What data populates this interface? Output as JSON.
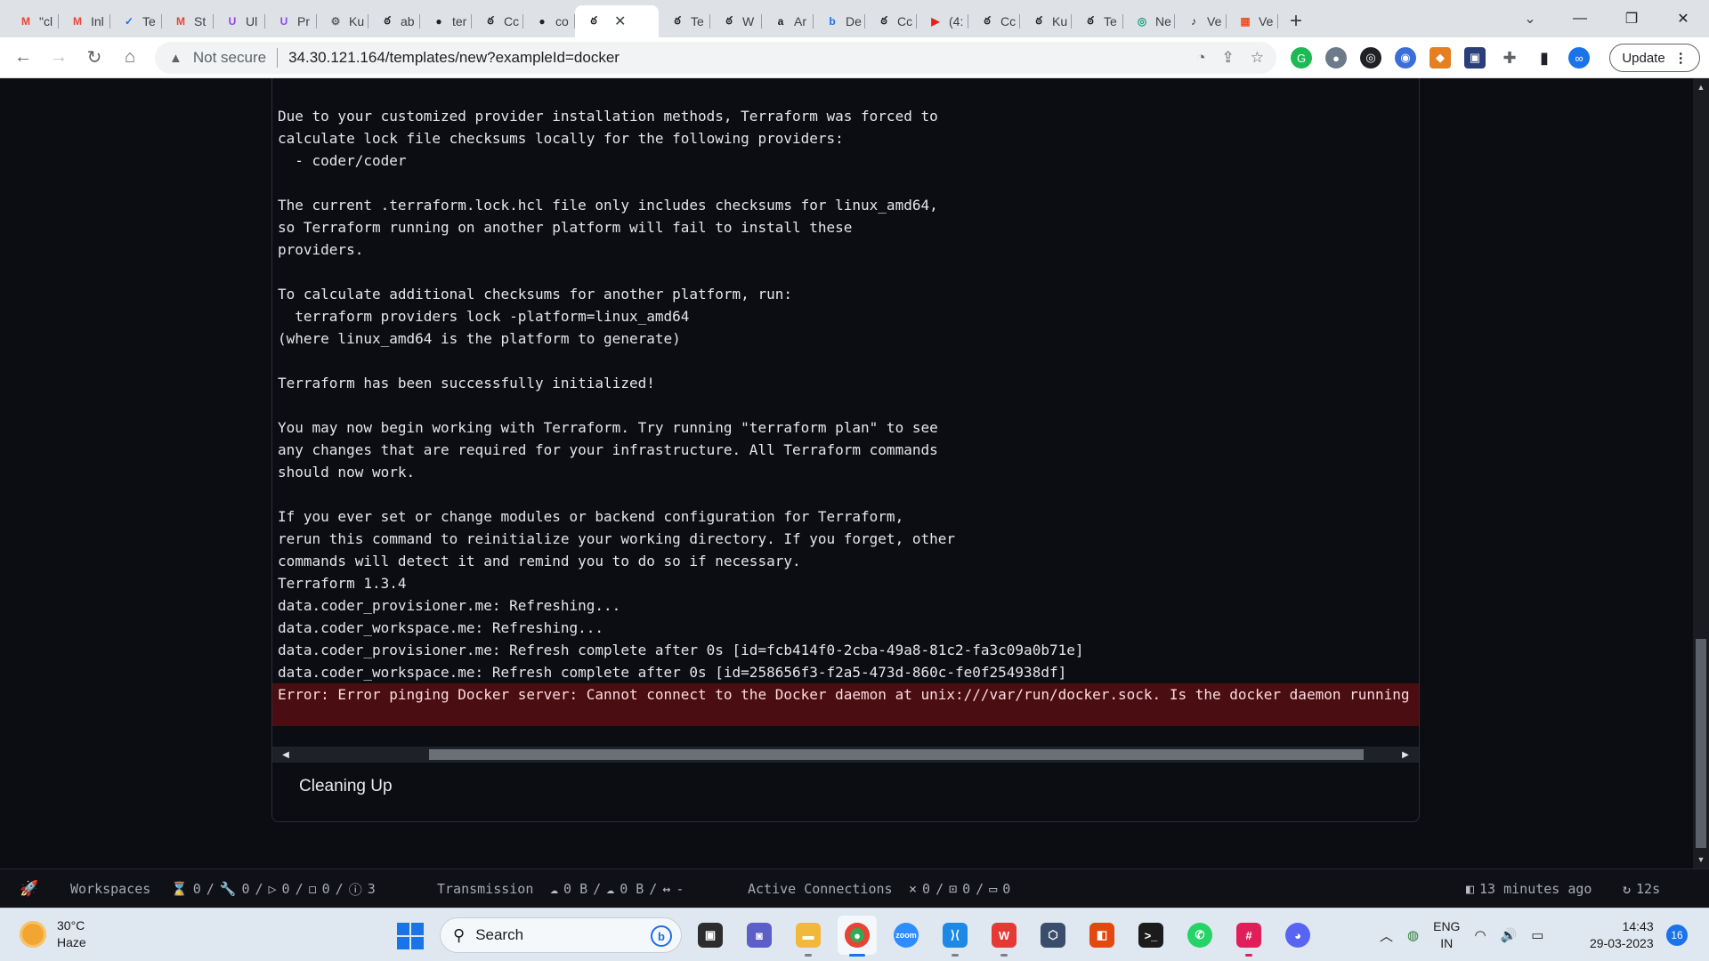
{
  "browser": {
    "tabs": [
      {
        "label": "\"cl",
        "icon": "gmail-icon",
        "glyph": "M",
        "color": "#ea4335"
      },
      {
        "label": "Inl",
        "icon": "gmail-icon",
        "glyph": "M",
        "color": "#ea4335"
      },
      {
        "label": "Te",
        "icon": "checkbox-app-icon",
        "glyph": "✓",
        "color": "#1a73e8"
      },
      {
        "label": "St",
        "icon": "gmail-icon",
        "glyph": "M",
        "color": "#ea4335"
      },
      {
        "label": "Ul",
        "icon": "purple-app-icon",
        "glyph": "U",
        "color": "#8e44ef"
      },
      {
        "label": "Pr",
        "icon": "purple-app-icon",
        "glyph": "U",
        "color": "#8e44ef"
      },
      {
        "label": "Ku",
        "icon": "gear-app-icon",
        "glyph": "⚙",
        "color": "#5f6368"
      },
      {
        "label": "ab",
        "icon": "coder-icon",
        "glyph": "ఠ",
        "color": "#202124"
      },
      {
        "label": "ter",
        "icon": "github-icon",
        "glyph": "●",
        "color": "#202124"
      },
      {
        "label": "Cc",
        "icon": "coder-icon",
        "glyph": "ఠ",
        "color": "#202124"
      },
      {
        "label": "co",
        "icon": "github-icon",
        "glyph": "●",
        "color": "#202124"
      },
      {
        "label": "",
        "icon": "coder-icon",
        "glyph": "ఠ",
        "color": "#202124",
        "active": true
      },
      {
        "label": "Te",
        "icon": "coder-icon",
        "glyph": "ఠ",
        "color": "#202124"
      },
      {
        "label": "W",
        "icon": "coder-icon",
        "glyph": "ఠ",
        "color": "#202124"
      },
      {
        "label": "Ar",
        "icon": "amazon-icon",
        "glyph": "a",
        "color": "#202124"
      },
      {
        "label": "De",
        "icon": "bing-app-icon",
        "glyph": "b",
        "color": "#1a73e8"
      },
      {
        "label": "Cc",
        "icon": "coder-icon",
        "glyph": "ఠ",
        "color": "#202124"
      },
      {
        "label": "(4:",
        "icon": "youtube-icon",
        "glyph": "▶",
        "color": "#e62117"
      },
      {
        "label": "Cc",
        "icon": "coder-icon",
        "glyph": "ఠ",
        "color": "#202124"
      },
      {
        "label": "Ku",
        "icon": "coder-icon",
        "glyph": "ఠ",
        "color": "#202124"
      },
      {
        "label": "Te",
        "icon": "coder-icon",
        "glyph": "ఠ",
        "color": "#202124"
      },
      {
        "label": "Ne",
        "icon": "chatgpt-icon",
        "glyph": "◎",
        "color": "#10a37f"
      },
      {
        "label": "Ve",
        "icon": "music-note-icon",
        "glyph": "♪",
        "color": "#202124"
      },
      {
        "label": "Ve",
        "icon": "microsoft-icon",
        "glyph": "▦",
        "color": "#f25022"
      }
    ],
    "security_label": "Not secure",
    "url": "34.30.121.164/templates/new?exampleId=docker",
    "update_label": "Update"
  },
  "log": {
    "lines": [
      "Due to your customized provider installation methods, Terraform was forced to",
      "calculate lock file checksums locally for the following providers:",
      "  - coder/coder",
      "",
      "The current .terraform.lock.hcl file only includes checksums for linux_amd64,",
      "so Terraform running on another platform will fail to install these",
      "providers.",
      "",
      "To calculate additional checksums for another platform, run:",
      "  terraform providers lock -platform=linux_amd64",
      "(where linux_amd64 is the platform to generate)",
      "",
      "Terraform has been successfully initialized!",
      "",
      "You may now begin working with Terraform. Try running \"terraform plan\" to see",
      "any changes that are required for your infrastructure. All Terraform commands",
      "should now work.",
      "",
      "If you ever set or change modules or backend configuration for Terraform,",
      "rerun this command to reinitialize your working directory. If you forget, other",
      "commands will detect it and remind you to do so if necessary.",
      "Terraform 1.3.4",
      "data.coder_provisioner.me: Refreshing...",
      "data.coder_workspace.me: Refreshing...",
      "data.coder_provisioner.me: Refresh complete after 0s [id=fcb414f0-2cba-49a8-81c2-fa3c09a0b71e]",
      "data.coder_workspace.me: Refresh complete after 0s [id=258656f3-f2a5-473d-860c-fe0f254938df]"
    ],
    "error": "Error: Error pinging Docker server: Cannot connect to the Docker daemon at unix:///var/run/docker.sock. Is the docker daemon running"
  },
  "stage": {
    "label": "Cleaning Up"
  },
  "statusbar": {
    "workspaces_label": "Workspaces",
    "pending": "0",
    "starting": "0",
    "running": "0",
    "stopped": "0",
    "failed": "3",
    "transmission_label": "Transmission",
    "upload": "0 B",
    "download": "0 B",
    "latency": "-",
    "connections_label": "Active Connections",
    "ssh": "0",
    "vscode": "0",
    "terminal": "0",
    "updated": "13 minutes ago",
    "refresh": "12s"
  },
  "taskbar": {
    "temperature": "30°C",
    "condition": "Haze",
    "search_placeholder": "Search",
    "lang_top": "ENG",
    "lang_bottom": "IN",
    "time": "14:43",
    "date": "29-03-2023",
    "notifications": "16"
  }
}
